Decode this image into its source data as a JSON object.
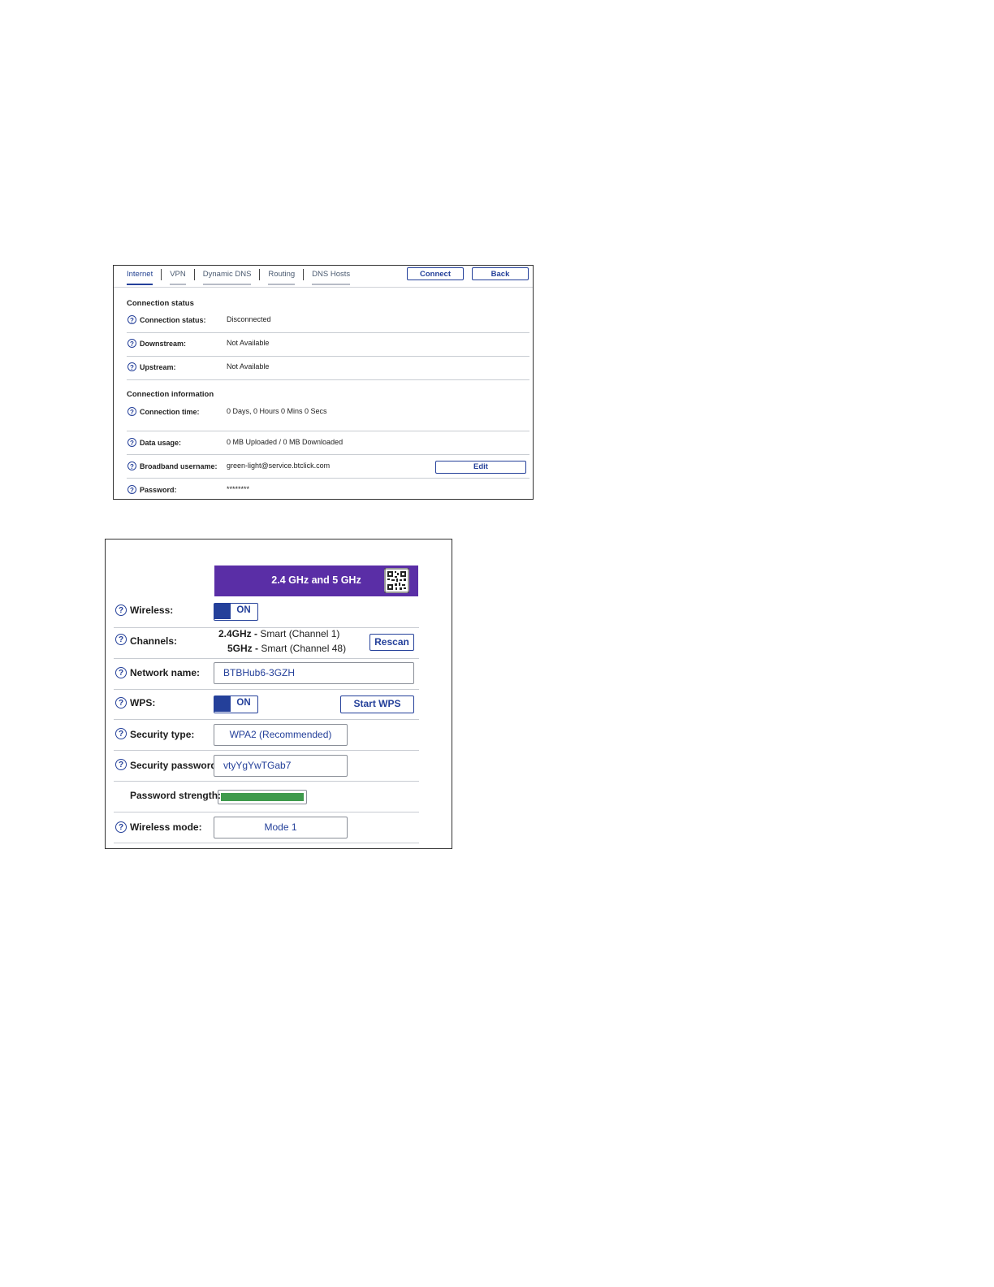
{
  "internet_panel": {
    "tabs": [
      {
        "label": "Internet",
        "active": true
      },
      {
        "label": "VPN",
        "active": false
      },
      {
        "label": "Dynamic DNS",
        "active": false
      },
      {
        "label": "Routing",
        "active": false
      },
      {
        "label": "DNS Hosts",
        "active": false
      }
    ],
    "connect_label": "Connect",
    "back_label": "Back",
    "connection_status_title": "Connection status",
    "status_rows": [
      {
        "label": "Connection status:",
        "value": "Disconnected"
      },
      {
        "label": "Downstream:",
        "value": "Not Available"
      },
      {
        "label": "Upstream:",
        "value": "Not Available"
      }
    ],
    "connection_info_title": "Connection information",
    "info_rows": [
      {
        "label": "Connection time:",
        "value": "0 Days, 0 Hours 0 Mins 0 Secs"
      },
      {
        "label": "Data usage:",
        "value": "0 MB Uploaded / 0 MB Downloaded"
      },
      {
        "label": "Broadband username:",
        "value": "green-light@service.btclick.com"
      },
      {
        "label": "Password:",
        "value": "********"
      }
    ],
    "edit_label": "Edit",
    "help_glyph": "?"
  },
  "wireless_panel": {
    "band_title": "2.4 GHz and 5 GHz",
    "band_color": "#5a2ea6",
    "accent_color": "#24409a",
    "qr_icon": "qr-code-icon",
    "wireless": {
      "label": "Wireless:",
      "toggle": "ON"
    },
    "channels": {
      "label": "Channels:",
      "band_24": "2.4GHz -",
      "band_24_value": " Smart (Channel 1)",
      "band_5": "5GHz -",
      "band_5_value": " Smart (Channel 48)",
      "rescan_label": "Rescan"
    },
    "network_name": {
      "label": "Network name:",
      "value": "BTBHub6-3GZH"
    },
    "wps": {
      "label": "WPS:",
      "toggle": "ON",
      "start_label": "Start WPS"
    },
    "security_type": {
      "label": "Security type:",
      "value": "WPA2 (Recommended)"
    },
    "security_password": {
      "label": "Security password:",
      "value": "vtyYgYwTGab7"
    },
    "password_strength": {
      "label": "Password strength:",
      "level": 1.0,
      "color": "#3f9a4d"
    },
    "wireless_mode": {
      "label": "Wireless mode:",
      "value": "Mode 1"
    },
    "help_glyph": "?"
  }
}
